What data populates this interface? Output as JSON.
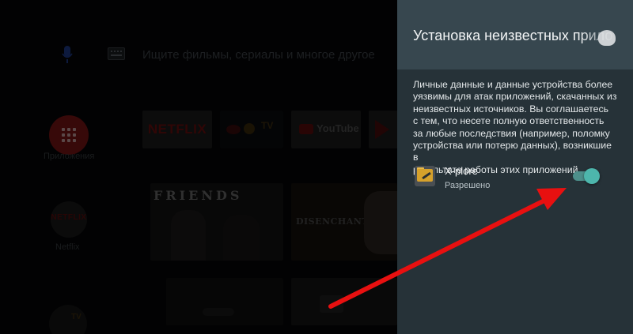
{
  "home": {
    "search_placeholder": "Ищите фильмы, сериалы и многое другое",
    "apps_label": "Приложения",
    "netflix_label": "Netflix",
    "netflix_circle_text": "NETFLIX",
    "tiles": {
      "netflix": "NETFLIX",
      "redbull": "TV",
      "youtube": "YouTube",
      "friends": "FRIENDS",
      "disenchantment": "DISENCHANTMENT"
    },
    "bottom_tv_text": "TV"
  },
  "panel": {
    "title": "Установка неизвестных прило",
    "description": "Личные данные и данные устройства более\nуязвимы для атак приложений, скачанных из\nнеизвестных источников. Вы соглашаетесь\nс тем, что несете полную ответственность\nза любые последствия (например, поломку\nустройства или потерю данных), возникшие в\nрезультате работы этих приложений.",
    "app": {
      "name": "X-plore",
      "status": "Разрешено",
      "enabled": true,
      "icon": "xplore-folder-icon"
    },
    "colors": {
      "panel_bg": "#263238",
      "header_bg": "#37474f",
      "toggle_on": "#4db6ac",
      "arrow": "#e81010"
    }
  }
}
